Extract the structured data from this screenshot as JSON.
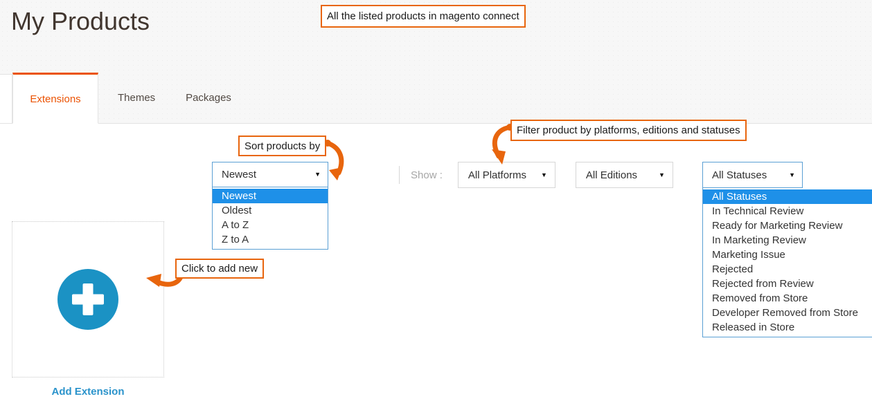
{
  "page": {
    "title": "My Products"
  },
  "tabs": [
    {
      "label": "Extensions",
      "active": true
    },
    {
      "label": "Themes",
      "active": false
    },
    {
      "label": "Packages",
      "active": false
    }
  ],
  "sort": {
    "selected": "Newest",
    "caret": "▼",
    "open": true,
    "options": [
      "Newest",
      "Oldest",
      "A to Z",
      "Z to A"
    ]
  },
  "filters": {
    "show_label": "Show :",
    "platforms": {
      "selected": "All Platforms",
      "caret": "▼"
    },
    "editions": {
      "selected": "All Editions",
      "caret": "▼"
    },
    "statuses": {
      "selected": "All Statuses",
      "caret": "▼",
      "open": true,
      "options": [
        "All Statuses",
        "In Technical Review",
        "Ready for Marketing Review",
        "In Marketing Review",
        "Marketing Issue",
        "Rejected",
        "Rejected from Review",
        "Removed from Store",
        "Developer Removed from Store",
        "Released in Store"
      ]
    }
  },
  "add_card": {
    "icon": "plus-circle-icon",
    "label": "Add Extension"
  },
  "annotations": {
    "listed_products": "All the listed products in magento connect",
    "sort_products": "Sort products by",
    "filter_products": "Filter product by platforms, editions and statuses",
    "click_to_add": "Click to add new"
  },
  "colors": {
    "accent_orange": "#eb5202",
    "annotation_orange": "#e8650d",
    "link_blue": "#2a93cb",
    "plus_circle_blue": "#1b92c4",
    "highlight_blue": "#1e90e8"
  }
}
